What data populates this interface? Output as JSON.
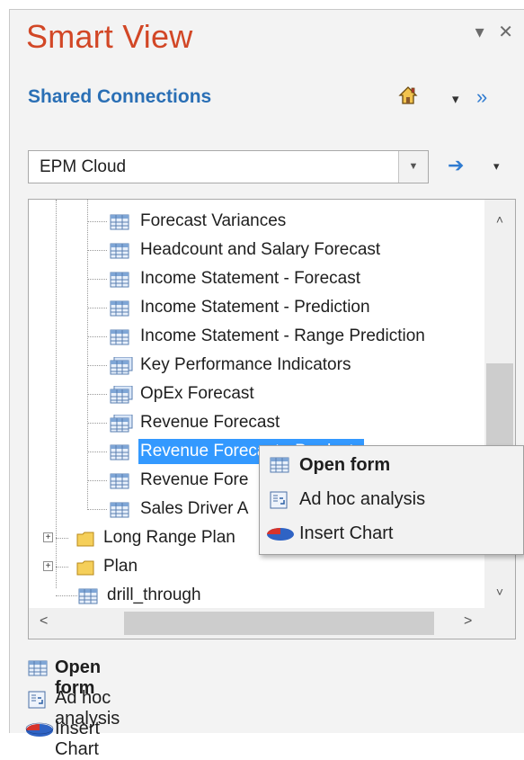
{
  "panel": {
    "title": "Smart View",
    "pin_glyph": "▾",
    "close_glyph": "✕"
  },
  "connections": {
    "label": "Shared Connections",
    "home_icon": "home-icon",
    "menu_glyph": "▾",
    "expand_glyph": "»"
  },
  "selector": {
    "value": "EPM Cloud",
    "dropdown_glyph": "▼",
    "go_glyph": "➔",
    "menu_glyph": "▾"
  },
  "tree": {
    "forms": [
      "Forecast Variances",
      "Headcount and Salary Forecast",
      "Income Statement - Forecast",
      "Income Statement - Prediction",
      "Income Statement - Range Prediction",
      "Key Performance Indicators",
      "OpEx Forecast",
      "Revenue Forecast",
      "Revenue Forecast - Products",
      "Revenue Fore",
      "Sales Driver A"
    ],
    "folders": [
      "Long Range Plan",
      "Plan"
    ],
    "root_item": "drill_through",
    "selected_index": 8
  },
  "scroll": {
    "up": "˄",
    "down": "˅",
    "left": "<",
    "right": ">"
  },
  "context_menu": {
    "open_form": "Open form",
    "ad_hoc": "Ad hoc analysis",
    "insert_chart": "Insert Chart"
  },
  "actions": {
    "open_form": "Open form",
    "ad_hoc": "Ad hoc analysis",
    "insert_chart": "Insert Chart"
  },
  "colors": {
    "title": "#d24726",
    "accent": "#2a6fb5",
    "selection": "#3399ff"
  }
}
